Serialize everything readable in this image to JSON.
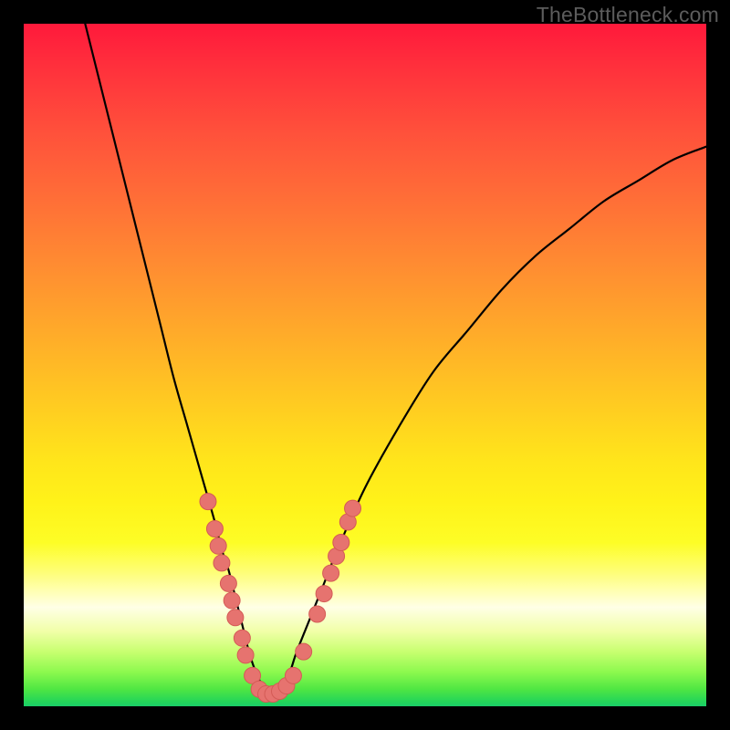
{
  "watermark": "TheBottleneck.com",
  "colors": {
    "frame": "#000000",
    "curve": "#000000",
    "marker_fill": "#e6736f",
    "marker_stroke": "#d45b56",
    "gradient_top": "#ff193b",
    "gradient_bottom": "#1ace68"
  },
  "chart_data": {
    "type": "line",
    "title": "",
    "xlabel": "",
    "ylabel": "",
    "xlim": [
      0,
      100
    ],
    "ylim": [
      0,
      100
    ],
    "grid": false,
    "legend": false,
    "note": "Axes unlabeled; values estimated from pixel positions. y=0 at bottom (green), y=100 at top (red). Curve is a V-shaped bottleneck profile with minimum near x≈35.",
    "series": [
      {
        "name": "bottleneck-curve",
        "x": [
          9,
          12,
          15,
          18,
          20,
          22,
          24,
          26,
          28,
          29,
          30,
          31,
          32,
          33,
          34,
          35,
          36,
          37,
          38,
          39,
          40,
          42,
          44,
          46,
          50,
          55,
          60,
          65,
          70,
          75,
          80,
          85,
          90,
          95,
          100
        ],
        "y": [
          100,
          88,
          76,
          64,
          56,
          48,
          41,
          34,
          27,
          23,
          20,
          16,
          12,
          8,
          5,
          3,
          2,
          2,
          3,
          5,
          8,
          13,
          18,
          23,
          32,
          41,
          49,
          55,
          61,
          66,
          70,
          74,
          77,
          80,
          82
        ]
      }
    ],
    "markers": {
      "name": "highlighted-points",
      "note": "Pink bead markers clustered near the valley of the curve.",
      "points": [
        {
          "x": 27.0,
          "y": 30.0
        },
        {
          "x": 28.0,
          "y": 26.0
        },
        {
          "x": 28.5,
          "y": 23.5
        },
        {
          "x": 29.0,
          "y": 21.0
        },
        {
          "x": 30.0,
          "y": 18.0
        },
        {
          "x": 30.5,
          "y": 15.5
        },
        {
          "x": 31.0,
          "y": 13.0
        },
        {
          "x": 32.0,
          "y": 10.0
        },
        {
          "x": 32.5,
          "y": 7.5
        },
        {
          "x": 33.5,
          "y": 4.5
        },
        {
          "x": 34.5,
          "y": 2.5
        },
        {
          "x": 35.5,
          "y": 1.8
        },
        {
          "x": 36.5,
          "y": 1.8
        },
        {
          "x": 37.5,
          "y": 2.2
        },
        {
          "x": 38.5,
          "y": 3.0
        },
        {
          "x": 39.5,
          "y": 4.5
        },
        {
          "x": 41.0,
          "y": 8.0
        },
        {
          "x": 43.0,
          "y": 13.5
        },
        {
          "x": 44.0,
          "y": 16.5
        },
        {
          "x": 45.0,
          "y": 19.5
        },
        {
          "x": 45.8,
          "y": 22.0
        },
        {
          "x": 46.5,
          "y": 24.0
        },
        {
          "x": 47.5,
          "y": 27.0
        },
        {
          "x": 48.2,
          "y": 29.0
        }
      ]
    }
  }
}
